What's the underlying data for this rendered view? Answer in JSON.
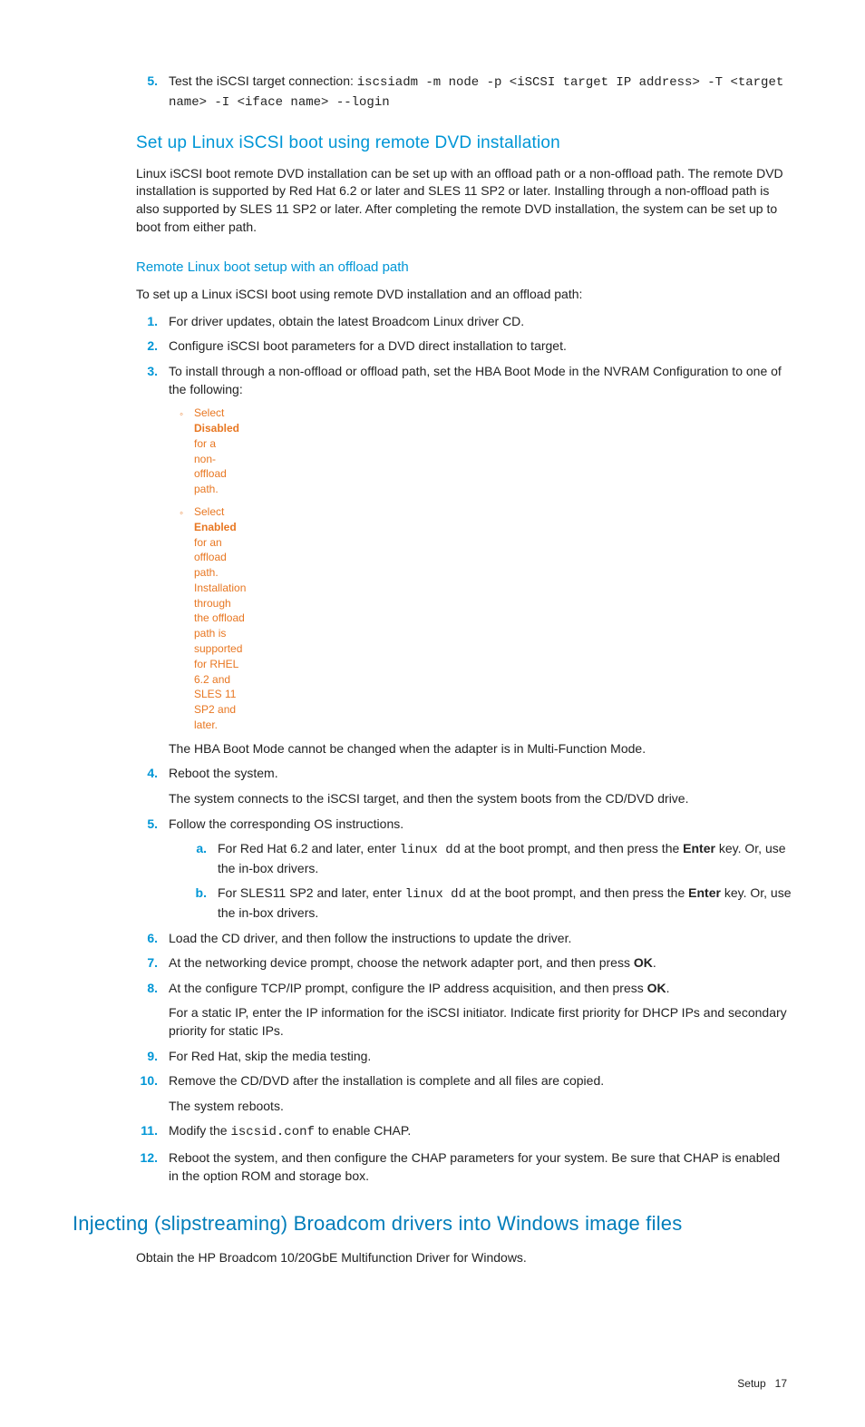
{
  "step5": {
    "num": "5.",
    "lead": "Test the iSCSI target connection: ",
    "code": "iscsiadm -m node -p <iSCSI target IP address> -T <target name> -I <iface name> --login"
  },
  "h3_setup": "Set up Linux iSCSI boot using remote DVD installation",
  "para_setup": "Linux iSCSI boot remote DVD installation can be set up with an offload path or a non-offload path. The remote DVD installation is supported by Red Hat 6.2 or later and SLES 11 SP2 or later. Installing through a non-offload path is also supported by SLES 11 SP2 or later. After completing the remote DVD installation, the system can be set up to boot from either path.",
  "h4_remote": "Remote Linux boot setup with an offload path",
  "para_remote": "To set up a Linux iSCSI boot using remote DVD installation and an offload path:",
  "steps": {
    "s1": {
      "num": "1.",
      "txt": "For driver updates, obtain the latest Broadcom Linux driver CD."
    },
    "s2": {
      "num": "2.",
      "txt": "Configure iSCSI boot parameters for a DVD direct installation to target."
    },
    "s3": {
      "num": "3.",
      "txt": "To install through a non-offload or offload path, set the HBA Boot Mode in the NVRAM Configuration to one of the following:",
      "b1": {
        "mark": "◦",
        "pre": "Select ",
        "bold": "Disabled",
        "post": " for a non-offload path."
      },
      "b2": {
        "mark": "◦",
        "pre": "Select ",
        "bold": "Enabled",
        "post": " for an offload path. Installation through the offload path is supported for RHEL 6.2 and SLES 11 SP2 and later."
      },
      "note": "The HBA Boot Mode cannot be changed when the adapter is in Multi-Function Mode."
    },
    "s4": {
      "num": "4.",
      "txt": "Reboot the system.",
      "note": "The system connects to the iSCSI target, and then the system boots from the CD/DVD drive."
    },
    "s5": {
      "num": "5.",
      "txt": "Follow the corresponding OS instructions.",
      "a": {
        "num": "a.",
        "pre": "For Red Hat 6.2 and later, enter ",
        "code": "linux dd",
        "mid": " at the boot prompt, and then press the ",
        "bold": "Enter",
        "post": " key. Or, use the in-box drivers."
      },
      "b": {
        "num": "b.",
        "pre": "For SLES11 SP2 and later, enter ",
        "code": "linux dd",
        "mid": " at the boot prompt, and then press the ",
        "bold": "Enter",
        "post": " key. Or, use the in-box drivers."
      }
    },
    "s6": {
      "num": "6.",
      "txt": "Load the CD driver, and then follow the instructions to update the driver."
    },
    "s7": {
      "num": "7.",
      "pre": "At the networking device prompt, choose the network adapter port, and then press ",
      "bold": "OK",
      "post": "."
    },
    "s8": {
      "num": "8.",
      "pre": "At the configure TCP/IP prompt, configure the IP address acquisition, and then press ",
      "bold": "OK",
      "post": ".",
      "note": "For a static IP, enter the IP information for the iSCSI initiator. Indicate first priority for DHCP IPs and secondary priority for static IPs."
    },
    "s9": {
      "num": "9.",
      "txt": "For Red Hat, skip the media testing."
    },
    "s10": {
      "num": "10.",
      "txt": "Remove the CD/DVD after the installation is complete and all files are copied.",
      "note": "The system reboots."
    },
    "s11": {
      "num": "11.",
      "pre": "Modify the ",
      "code": "iscsid.conf",
      "post": " to enable CHAP."
    },
    "s12": {
      "num": "12.",
      "txt": "Reboot the system, and then configure the CHAP parameters for your system. Be sure that CHAP is enabled in the option ROM and storage box."
    }
  },
  "h2_inject": "Injecting (slipstreaming) Broadcom drivers into Windows image files",
  "para_inject": "Obtain the HP Broadcom 10/20GbE Multifunction Driver for Windows.",
  "footer": {
    "section": "Setup",
    "page": "17"
  }
}
